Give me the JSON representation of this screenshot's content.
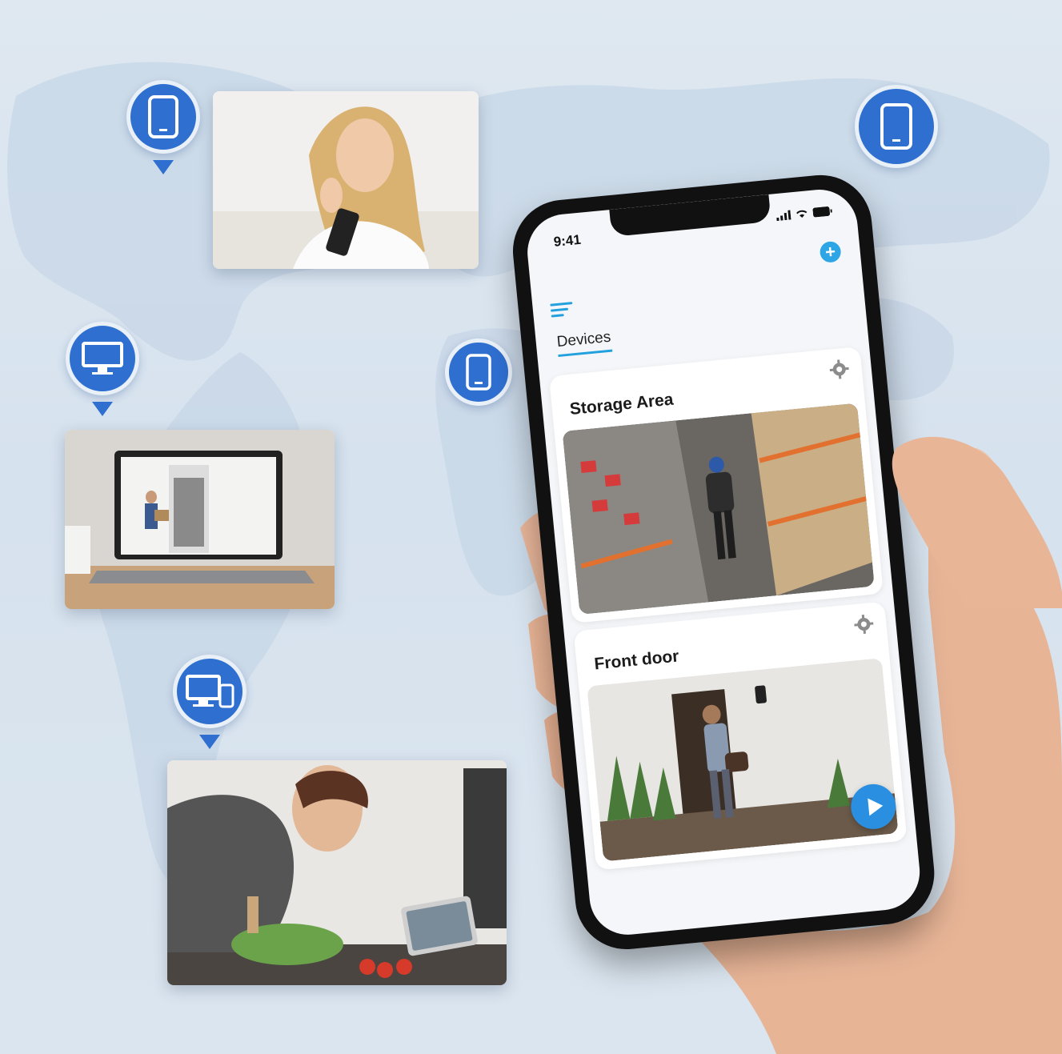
{
  "phone": {
    "status_time": "9:41",
    "tab_label": "Devices",
    "cameras": [
      {
        "name": "Storage Area"
      },
      {
        "name": "Front door"
      }
    ]
  },
  "colors": {
    "pin_blue": "#2f6fd0",
    "accent": "#23a1de",
    "play_button": "#2a8fe0"
  },
  "icons": {
    "pins": [
      "phone-icon",
      "monitor-icon",
      "desktop-and-phone-icon",
      "phone-icon",
      "phone-icon"
    ],
    "phone_ui": [
      "signal-icon",
      "wifi-icon",
      "battery-icon",
      "add-icon",
      "menu-icon",
      "gear-icon",
      "play-icon"
    ]
  }
}
